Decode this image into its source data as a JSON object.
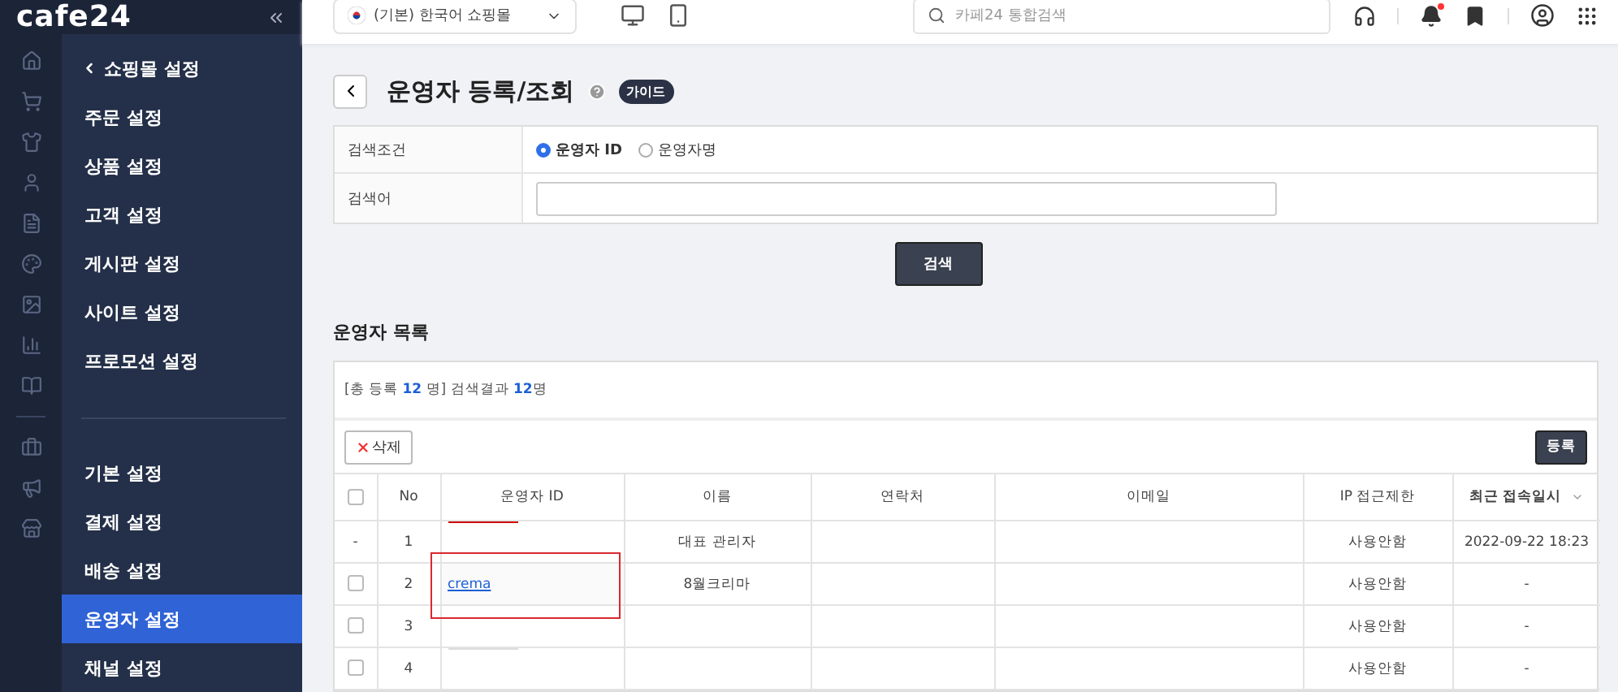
{
  "sidebar": {
    "logo": "cafe24",
    "menu_back": "쇼핑몰 설정",
    "groups": [
      [
        {
          "label": "주문 설정",
          "selected": false
        },
        {
          "label": "상품 설정",
          "selected": false
        },
        {
          "label": "고객 설정",
          "selected": false
        },
        {
          "label": "게시판 설정",
          "selected": false
        },
        {
          "label": "사이트 설정",
          "selected": false
        },
        {
          "label": "프로모션 설정",
          "selected": false
        }
      ],
      [
        {
          "label": "기본 설정",
          "selected": false
        },
        {
          "label": "결제 설정",
          "selected": false
        },
        {
          "label": "배송 설정",
          "selected": false
        },
        {
          "label": "운영자 설정",
          "selected": true
        },
        {
          "label": "채널 설정",
          "selected": false
        }
      ]
    ]
  },
  "topbar": {
    "shop_select": "(기본) 한국어 쇼핑몰",
    "search_placeholder": "카페24 통합검색",
    "notification_dot": true
  },
  "page": {
    "title": "운영자 등록/조회",
    "guide": "가이드"
  },
  "search_form": {
    "rows": [
      {
        "kind": "radio",
        "label": "검색조건",
        "options": [
          {
            "label": "운영자 ID",
            "selected": true
          },
          {
            "label": "운영자명",
            "selected": false
          }
        ]
      },
      {
        "kind": "text",
        "label": "검색어"
      }
    ],
    "submit": "검색"
  },
  "list": {
    "title": "운영자 목록",
    "summary": {
      "prefix": "[총 등록 ",
      "total": "12",
      "middle": " 명] 검색결과 ",
      "found": "12",
      "suffix": "명"
    },
    "select_all_checked": false,
    "delete": "삭제",
    "register": "등록",
    "columns": [
      {
        "label": "No",
        "sorted": false
      },
      {
        "label": "운영자 ID",
        "sorted": false
      },
      {
        "label": "이름",
        "sorted": false
      },
      {
        "label": "연락처",
        "sorted": false
      },
      {
        "label": "이메일",
        "sorted": false
      },
      {
        "label": "IP 접근제한",
        "sorted": false
      },
      {
        "label": "최근 접속일시",
        "sorted": true
      }
    ],
    "rows": [
      {
        "kind": "fixed",
        "mark": "-",
        "no": "1",
        "redaction_mark": {
          "color": "#cc0000"
        },
        "name": "대표 관리자",
        "ip": "사용안함",
        "last_access": "2022-09-22 18:23",
        "highlighted": false
      },
      {
        "kind": "selectable",
        "checked": false,
        "no": "2",
        "id": "crema",
        "name": "8월크리마",
        "ip": "사용안함",
        "last_access": "-",
        "highlighted": true
      },
      {
        "kind": "selectable",
        "checked": false,
        "no": "3",
        "ip": "사용안함",
        "last_access": "-",
        "highlighted": false
      },
      {
        "kind": "selectable",
        "checked": false,
        "no": "4",
        "redaction_mark": {
          "color": "#dcdcdc"
        },
        "ip": "사용안함",
        "last_access": "-",
        "highlighted": false
      }
    ]
  }
}
